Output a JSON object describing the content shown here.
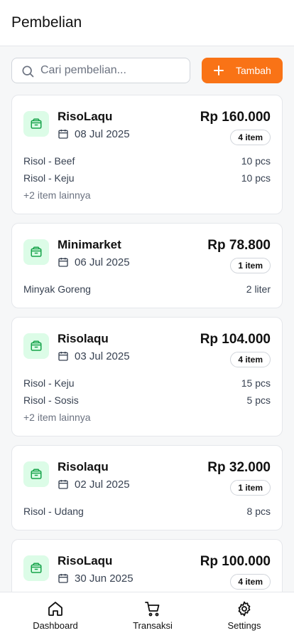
{
  "header": {
    "title": "Pembelian"
  },
  "search": {
    "placeholder": "Cari pembelian...",
    "value": ""
  },
  "toolbar": {
    "add_label": "Tambah"
  },
  "purchases": [
    {
      "store": "RisoLaqu",
      "date": "08 Jul 2025",
      "total": "Rp 160.000",
      "count": "4 item",
      "items": [
        {
          "name": "Risol - Beef",
          "qty": "10 pcs"
        },
        {
          "name": "Risol - Keju",
          "qty": "10 pcs"
        }
      ],
      "more": "+2 item lainnya"
    },
    {
      "store": "Minimarket",
      "date": "06 Jul 2025",
      "total": "Rp 78.800",
      "count": "1 item",
      "items": [
        {
          "name": "Minyak Goreng",
          "qty": "2 liter"
        }
      ],
      "more": ""
    },
    {
      "store": "Risolaqu",
      "date": "03 Jul 2025",
      "total": "Rp 104.000",
      "count": "4 item",
      "items": [
        {
          "name": "Risol - Keju",
          "qty": "15 pcs"
        },
        {
          "name": "Risol - Sosis",
          "qty": "5 pcs"
        }
      ],
      "more": "+2 item lainnya"
    },
    {
      "store": "Risolaqu",
      "date": "02 Jul 2025",
      "total": "Rp 32.000",
      "count": "1 item",
      "items": [
        {
          "name": "Risol - Udang",
          "qty": "8 pcs"
        }
      ],
      "more": ""
    },
    {
      "store": "RisoLaqu",
      "date": "30 Jun 2025",
      "total": "Rp 100.000",
      "count": "4 item",
      "items": [],
      "more": ""
    }
  ],
  "nav": {
    "dashboard": "Dashboard",
    "transaksi": "Transaksi",
    "settings": "Settings"
  },
  "colors": {
    "accent": "#f97316",
    "icon_green": "#16a34a",
    "icon_bg": "#dcfce7"
  },
  "icons": {
    "search": "search-icon",
    "add": "plus-icon",
    "store": "package-icon",
    "date": "calendar-icon",
    "dashboard": "home-icon",
    "transaksi": "cart-icon",
    "settings": "gear-icon"
  }
}
